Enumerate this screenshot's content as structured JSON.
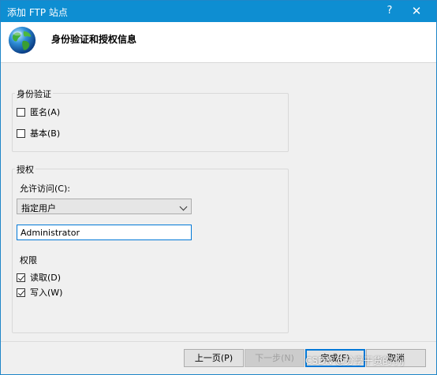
{
  "window": {
    "title": "添加 FTP 站点",
    "help_label": "?",
    "close_label": "✕"
  },
  "header": {
    "title": "身份验证和授权信息",
    "icon": "globe-icon"
  },
  "authentication": {
    "legend": "身份验证",
    "anonymous": {
      "label": "匿名(A)",
      "checked": false
    },
    "basic": {
      "label": "基本(B)",
      "checked": false
    }
  },
  "authorization": {
    "legend": "授权",
    "allow_access_label": "允许访问(C):",
    "allow_access_value": "指定用户",
    "users_value": "Administrator",
    "permissions_label": "权限",
    "read": {
      "label": "读取(D)",
      "checked": true
    },
    "write": {
      "label": "写入(W)",
      "checked": true
    }
  },
  "buttons": {
    "previous": "上一页(P)",
    "next": "下一步(N)",
    "finish": "完成(F)",
    "cancel": "取消"
  },
  "watermark": "CSDN @分享干货的小J"
}
